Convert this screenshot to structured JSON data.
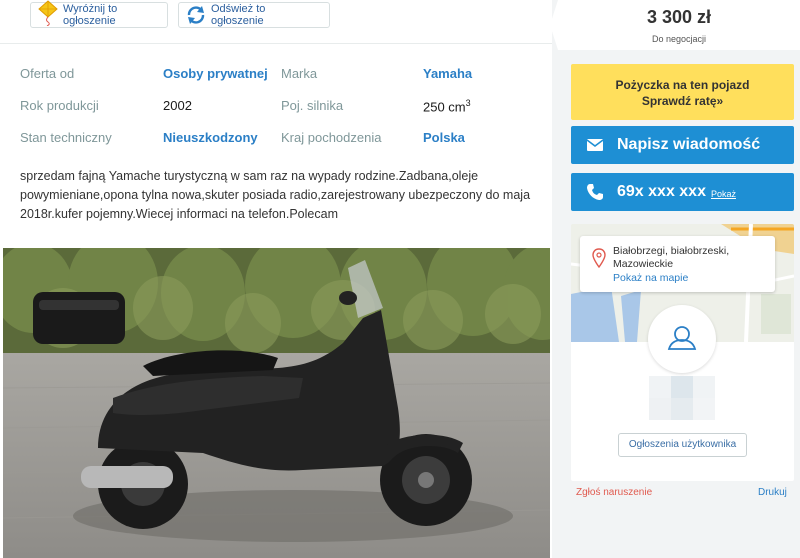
{
  "actions": {
    "highlight_label": "Wyróżnij to ogłoszenie",
    "refresh_label": "Odśwież to ogłoszenie"
  },
  "params": [
    {
      "label": "Oferta od",
      "value": "Osoby prywatnej",
      "link": true
    },
    {
      "label": "Marka",
      "value": "Yamaha",
      "link": true
    },
    {
      "label": "Rok produkcji",
      "value": "2002",
      "link": false
    },
    {
      "label": "Poj. silnika",
      "value": "250 cm",
      "sup": "3",
      "link": false
    },
    {
      "label": "Stan techniczny",
      "value": "Nieuszkodzony",
      "link": true
    },
    {
      "label": "Kraj pochodzenia",
      "value": "Polska",
      "link": true
    }
  ],
  "description": "sprzedam fajną Yamache turystyczną w sam raz na wypady rodzine.Zadbana,oleje powymieniane,opona tylna nowa,skuter posiada radio,zarejestrowany ubezpeczony do maja 2018r.kufer pojemny.Wiecej informaci na telefon.Polecam",
  "price": {
    "amount": "3 300 zł",
    "note": "Do negocjacji"
  },
  "loan": {
    "line1": "Pożyczka na ten pojazd",
    "line2": "Sprawdź ratę»"
  },
  "contact": {
    "message_label": "Napisz wiadomość",
    "phone": "69x xxx xxx",
    "phone_show": "Pokaż"
  },
  "location": {
    "line1": "Białobrzegi, białobrzeski,",
    "line2": "Mazowieckie",
    "map_link": "Pokaż na mapie"
  },
  "user": {
    "ads_label": "Ogłoszenia użytkownika"
  },
  "footer": {
    "report_label": "Zgłoś naruszenie",
    "print_label": "Drukuj"
  },
  "colors": {
    "accent_blue": "#1e8fd4",
    "loan_yellow": "#ffdf5c",
    "link_blue": "#2b7fc6",
    "report_red": "#e05a4f"
  },
  "icons": {
    "highlight": "kite-icon",
    "refresh": "refresh-icon",
    "message": "envelope-icon",
    "phone": "phone-icon",
    "location": "map-pin-icon",
    "avatar": "user-icon"
  }
}
